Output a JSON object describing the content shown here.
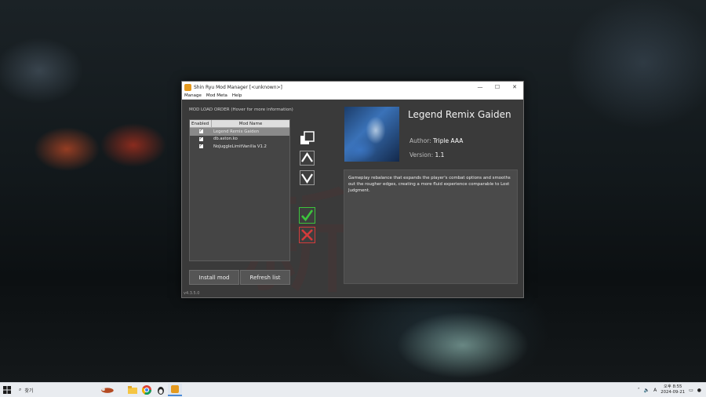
{
  "window": {
    "title": "Shin Ryu Mod Manager [<unknown>]",
    "minimize": "—",
    "maximize": "☐",
    "close": "✕"
  },
  "menu": [
    "Manage",
    "Mod Meta",
    "Help"
  ],
  "load_order": {
    "label": "MOD LOAD ORDER (Hover for more information)",
    "col_enabled": "Enabled",
    "col_name": "Mod Name",
    "mods": [
      {
        "name": "Legend Remix Gaiden",
        "enabled": true,
        "selected": true
      },
      {
        "name": "db.aston.ko",
        "enabled": true,
        "selected": false
      },
      {
        "name": "NoJuggleLimitVanilla V1.2",
        "enabled": true,
        "selected": false
      }
    ]
  },
  "buttons": {
    "install": "Install mod",
    "refresh": "Refresh list"
  },
  "side_icons": {
    "toggle": "toggle-all-icon",
    "up": "move-up-icon",
    "down": "move-down-icon",
    "enable": "enable-check-icon",
    "disable": "disable-x-icon"
  },
  "details": {
    "title": "Legend Remix Gaiden",
    "author_label": "Author:",
    "author": "Triple AAA",
    "version_label": "Version:",
    "version": "1.1",
    "description": "Gameplay rebalance that expands the player's combat options and smooths out the rougher edges, creating a more fluid experience comparable to Lost Judgment."
  },
  "app_version": "v4.3.5.0",
  "taskbar": {
    "search_text": "찾기",
    "clock_time": "오후 8:55",
    "clock_date": "2024-09-21",
    "tray_lang": "A"
  },
  "colors": {
    "accent_green": "#3cc43c",
    "accent_red": "#d43b3b",
    "window_bg": "#3a3a3a"
  }
}
